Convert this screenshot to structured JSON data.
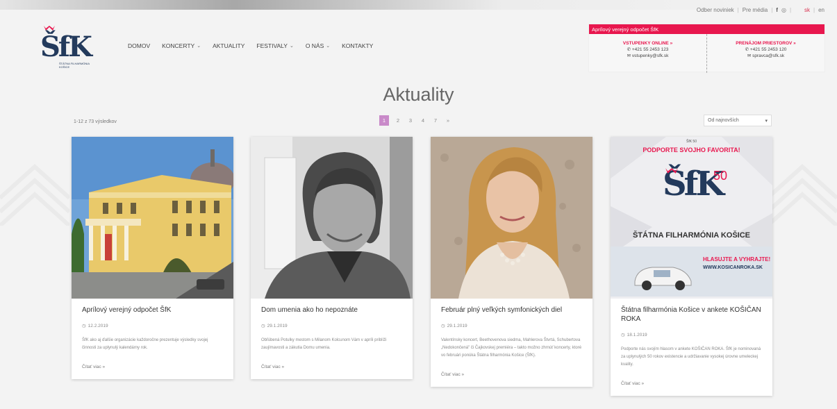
{
  "util": {
    "newsletter": "Odber noviniek",
    "media": "Pre média",
    "social1": "f",
    "social2": "◎",
    "lang_sk": "sk",
    "lang_en": "en"
  },
  "logo": {
    "mark": "ŠfK",
    "sub": "ŠTÁTNA FILHARMÓNIA KOŠICE"
  },
  "nav": [
    {
      "label": "DOMOV",
      "dropdown": false
    },
    {
      "label": "KONCERTY",
      "dropdown": true
    },
    {
      "label": "AKTUALITY",
      "dropdown": false
    },
    {
      "label": "FESTIVALY",
      "dropdown": true
    },
    {
      "label": "O NÁS",
      "dropdown": true
    },
    {
      "label": "KONTAKTY",
      "dropdown": false
    }
  ],
  "promo": {
    "bar": "Aprílový verejný odpočet ŠfK",
    "left": {
      "title": "VSTUPENKY ONLINE »",
      "phone": "+421 55 2453 123",
      "email": "vstupenky@sfk.sk"
    },
    "right": {
      "title": "PRENÁJOM PRIESTOROV »",
      "phone": "+421 55 2453 120",
      "email": "spravca@sfk.sk"
    }
  },
  "heading": "Aktuality",
  "results": "1-12 z 73 výsledkov",
  "pager": [
    "1",
    "2",
    "3",
    "4",
    "7",
    "»"
  ],
  "sort": {
    "label": "Od najnovších",
    "arrow": "▾"
  },
  "cards": [
    {
      "title": "Aprílový verejný odpočet ŠfK",
      "date": "12.2.2019",
      "excerpt": "ŠfK ako aj ďalšie organizácie každoročne prezentuje výsledky svojej činnosti za uplynulý kalendárny rok.",
      "more": "Čítať viac »"
    },
    {
      "title": "Dom umenia ako ho nepoznáte",
      "date": "29.1.2019",
      "excerpt": "Obľúbená Potulky mestom s Milanom Kolcunom Vám v apríli priblíži zaujímavosti a zákutia Domu umenia.",
      "more": "Čítať viac »"
    },
    {
      "title": "Február plný veľkých symfonických diel",
      "date": "29.1.2019",
      "excerpt": "Valentínsky koncert, Beethovenova siedma, Mahlerova Štvrtá, Schubertova „Nedokončená\" či Čajkovskej premiéra – takto možno zhrnúť koncerty, ktoré vo februári ponúka Štátna filharmónia Košice (ŠfK).",
      "more": "Čítať viac »"
    },
    {
      "title": "Štátna filharmónia Košice v ankete KOŠIČAN ROKA",
      "date": "18.1.2019",
      "excerpt": "Podporte nás svojím hlasom v ankete KOŠIČAN ROKA. ŠfK je nominovaná za uplynulých 50 rokov existencie a udržiavanie vysokej úrovne umeleckej kvality.",
      "more": "Čítať viac »"
    }
  ],
  "poster": {
    "top": "ŠfK 50",
    "headline": "PODPORTE SVOJHO FAVORITA!",
    "name": "ŠTÁTNA FILHARMÓNIA KOŠICE",
    "cta": "HLASUJTE A VYHRAJTE!",
    "site": "WWW.KOSICANROKA.SK"
  },
  "colors": {
    "accent": "#e8174e",
    "brand": "#233a5c",
    "pager_active": "#c98ac9"
  }
}
